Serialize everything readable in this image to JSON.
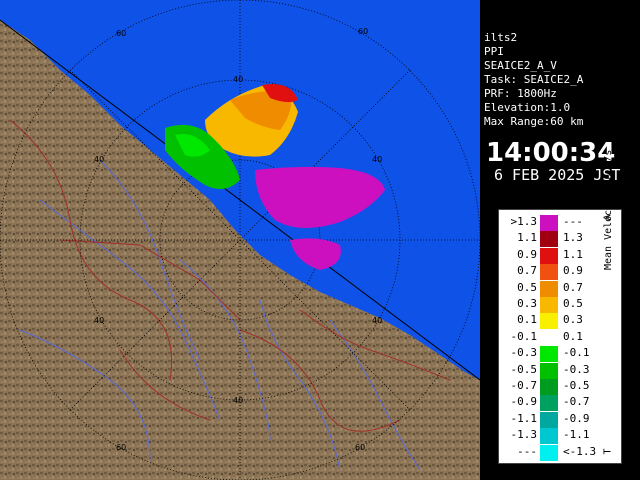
{
  "map": {
    "range_rings": [
      "40",
      "60"
    ],
    "colors": {
      "sea": "#0f52e8",
      "land": "#8b7355",
      "river": "#5a6bd8",
      "boundary": "#a0302a",
      "rings": "#000000"
    }
  },
  "info": {
    "station": "ilts2",
    "product": "PPI",
    "name": "SEAICE2_A_V",
    "task": "Task: SEAICE2_A",
    "prf": "PRF: 1800Hz",
    "elevation": "Elevation:1.0",
    "max_range": "Max Range:60 km",
    "time": "14:00:34",
    "date": "6 FEB 2025 JST"
  },
  "legend": {
    "title": "Mean Velocity in m/s",
    "marker_top": "A",
    "marker_bottom": "T",
    "rows": [
      {
        "left": ">1.3",
        "right": "---",
        "color": "#cc10c0"
      },
      {
        "left": "1.1",
        "right": "1.3",
        "color": "#a00010"
      },
      {
        "left": "0.9",
        "right": "1.1",
        "color": "#e01010"
      },
      {
        "left": "0.7",
        "right": "0.9",
        "color": "#f05010"
      },
      {
        "left": "0.5",
        "right": "0.7",
        "color": "#f08c00"
      },
      {
        "left": "0.3",
        "right": "0.5",
        "color": "#f8b800"
      },
      {
        "left": "0.1",
        "right": "0.3",
        "color": "#f8f000"
      },
      {
        "left": "-0.1",
        "right": "0.1",
        "color": "#ffffff"
      },
      {
        "left": "-0.3",
        "right": "-0.1",
        "color": "#00e800"
      },
      {
        "left": "-0.5",
        "right": "-0.3",
        "color": "#00c000"
      },
      {
        "left": "-0.7",
        "right": "-0.5",
        "color": "#009c20"
      },
      {
        "left": "-0.9",
        "right": "-0.7",
        "color": "#00a060"
      },
      {
        "left": "-1.1",
        "right": "-0.9",
        "color": "#00a8a0"
      },
      {
        "left": "-1.3",
        "right": "-1.1",
        "color": "#00c8d0"
      },
      {
        "left": "---",
        "right": "<-1.3",
        "color": "#00f0f0"
      }
    ]
  }
}
